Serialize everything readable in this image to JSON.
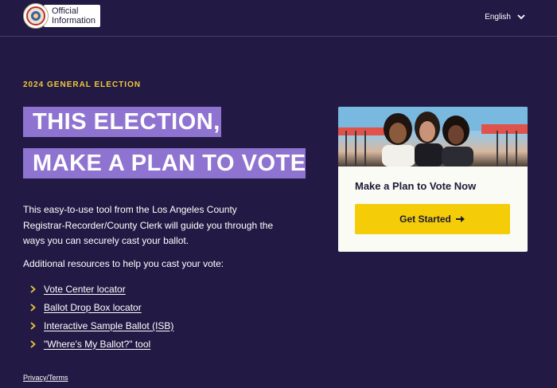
{
  "header": {
    "logo_line1": "Official",
    "logo_line2": "Information",
    "language": "English"
  },
  "hero": {
    "eyebrow": "2024 GENERAL ELECTION",
    "line1": "THIS ELECTION,",
    "line2": "MAKE A PLAN TO VOTE"
  },
  "intro": "This easy-to-use tool from the Los Angeles County Registrar-Recorder/County Clerk will guide you through the ways you can securely cast your ballot.",
  "resources": {
    "heading": "Additional resources to help you cast your vote:",
    "links": [
      {
        "label": "Vote Center locator"
      },
      {
        "label": "Ballot Drop Box locator"
      },
      {
        "label": "Interactive Sample Ballot (ISB)"
      },
      {
        "label": "\"Where's My Ballot?\" tool"
      }
    ]
  },
  "card": {
    "title": "Make a Plan to Vote Now",
    "cta": "Get Started"
  },
  "footer": {
    "privacy": "Privacy/Terms"
  },
  "icons": {
    "seal": "county-seal-icon",
    "language_toggle": "chevron-down-icon",
    "link_bullet": "chevron-right-icon",
    "cta_arrow": "arrow-right-icon"
  },
  "colors": {
    "background": "#221a44",
    "accent_purple": "#8f73d1",
    "accent_yellow": "#f4cd08",
    "eyebrow_gold": "#f0c93a",
    "card_bg": "#fbfbf6"
  }
}
